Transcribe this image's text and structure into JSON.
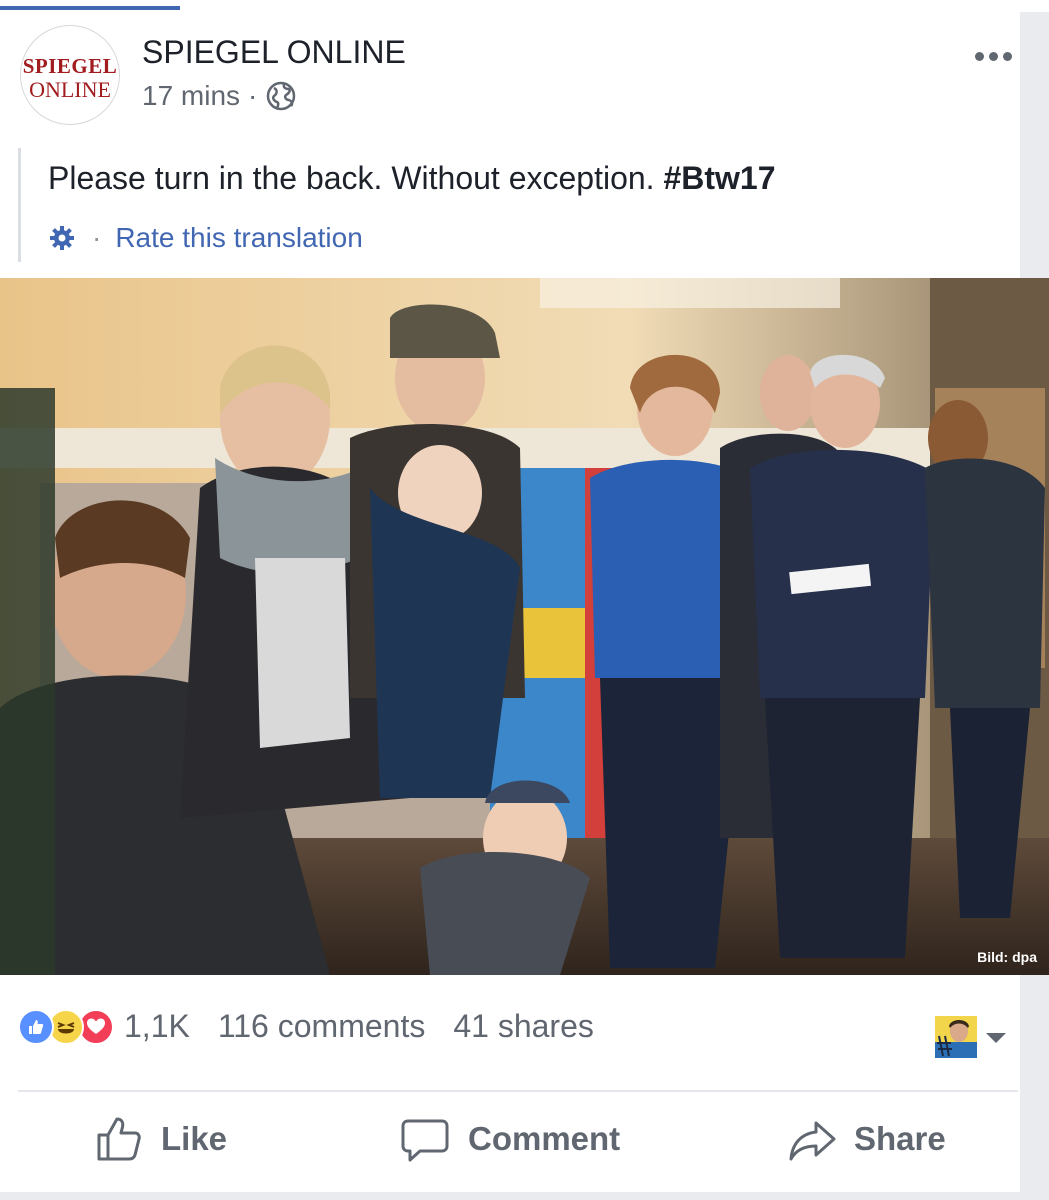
{
  "page": {
    "name": "SPIEGEL ONLINE",
    "logo_line1": "SPIEGEL",
    "logo_line2": "ONLINE",
    "time": "17 mins",
    "dot": "·",
    "privacy_icon": "globe-icon"
  },
  "post": {
    "text": "Please turn in the back. Without exception.",
    "hashtag": "#Btw17",
    "translation_link": "Rate this translation",
    "translation_sep": "·",
    "photo_credit": "Bild: dpa"
  },
  "stats": {
    "reactions": [
      "like",
      "haha",
      "love"
    ],
    "reaction_count": "1,1K",
    "comments": "116 comments",
    "shares": "41 shares"
  },
  "actions": {
    "like": "Like",
    "comment": "Comment",
    "share": "Share"
  },
  "colors": {
    "link": "#4267b2",
    "text": "#1d2129",
    "muted": "#616770",
    "brand": "#a11b1f"
  }
}
